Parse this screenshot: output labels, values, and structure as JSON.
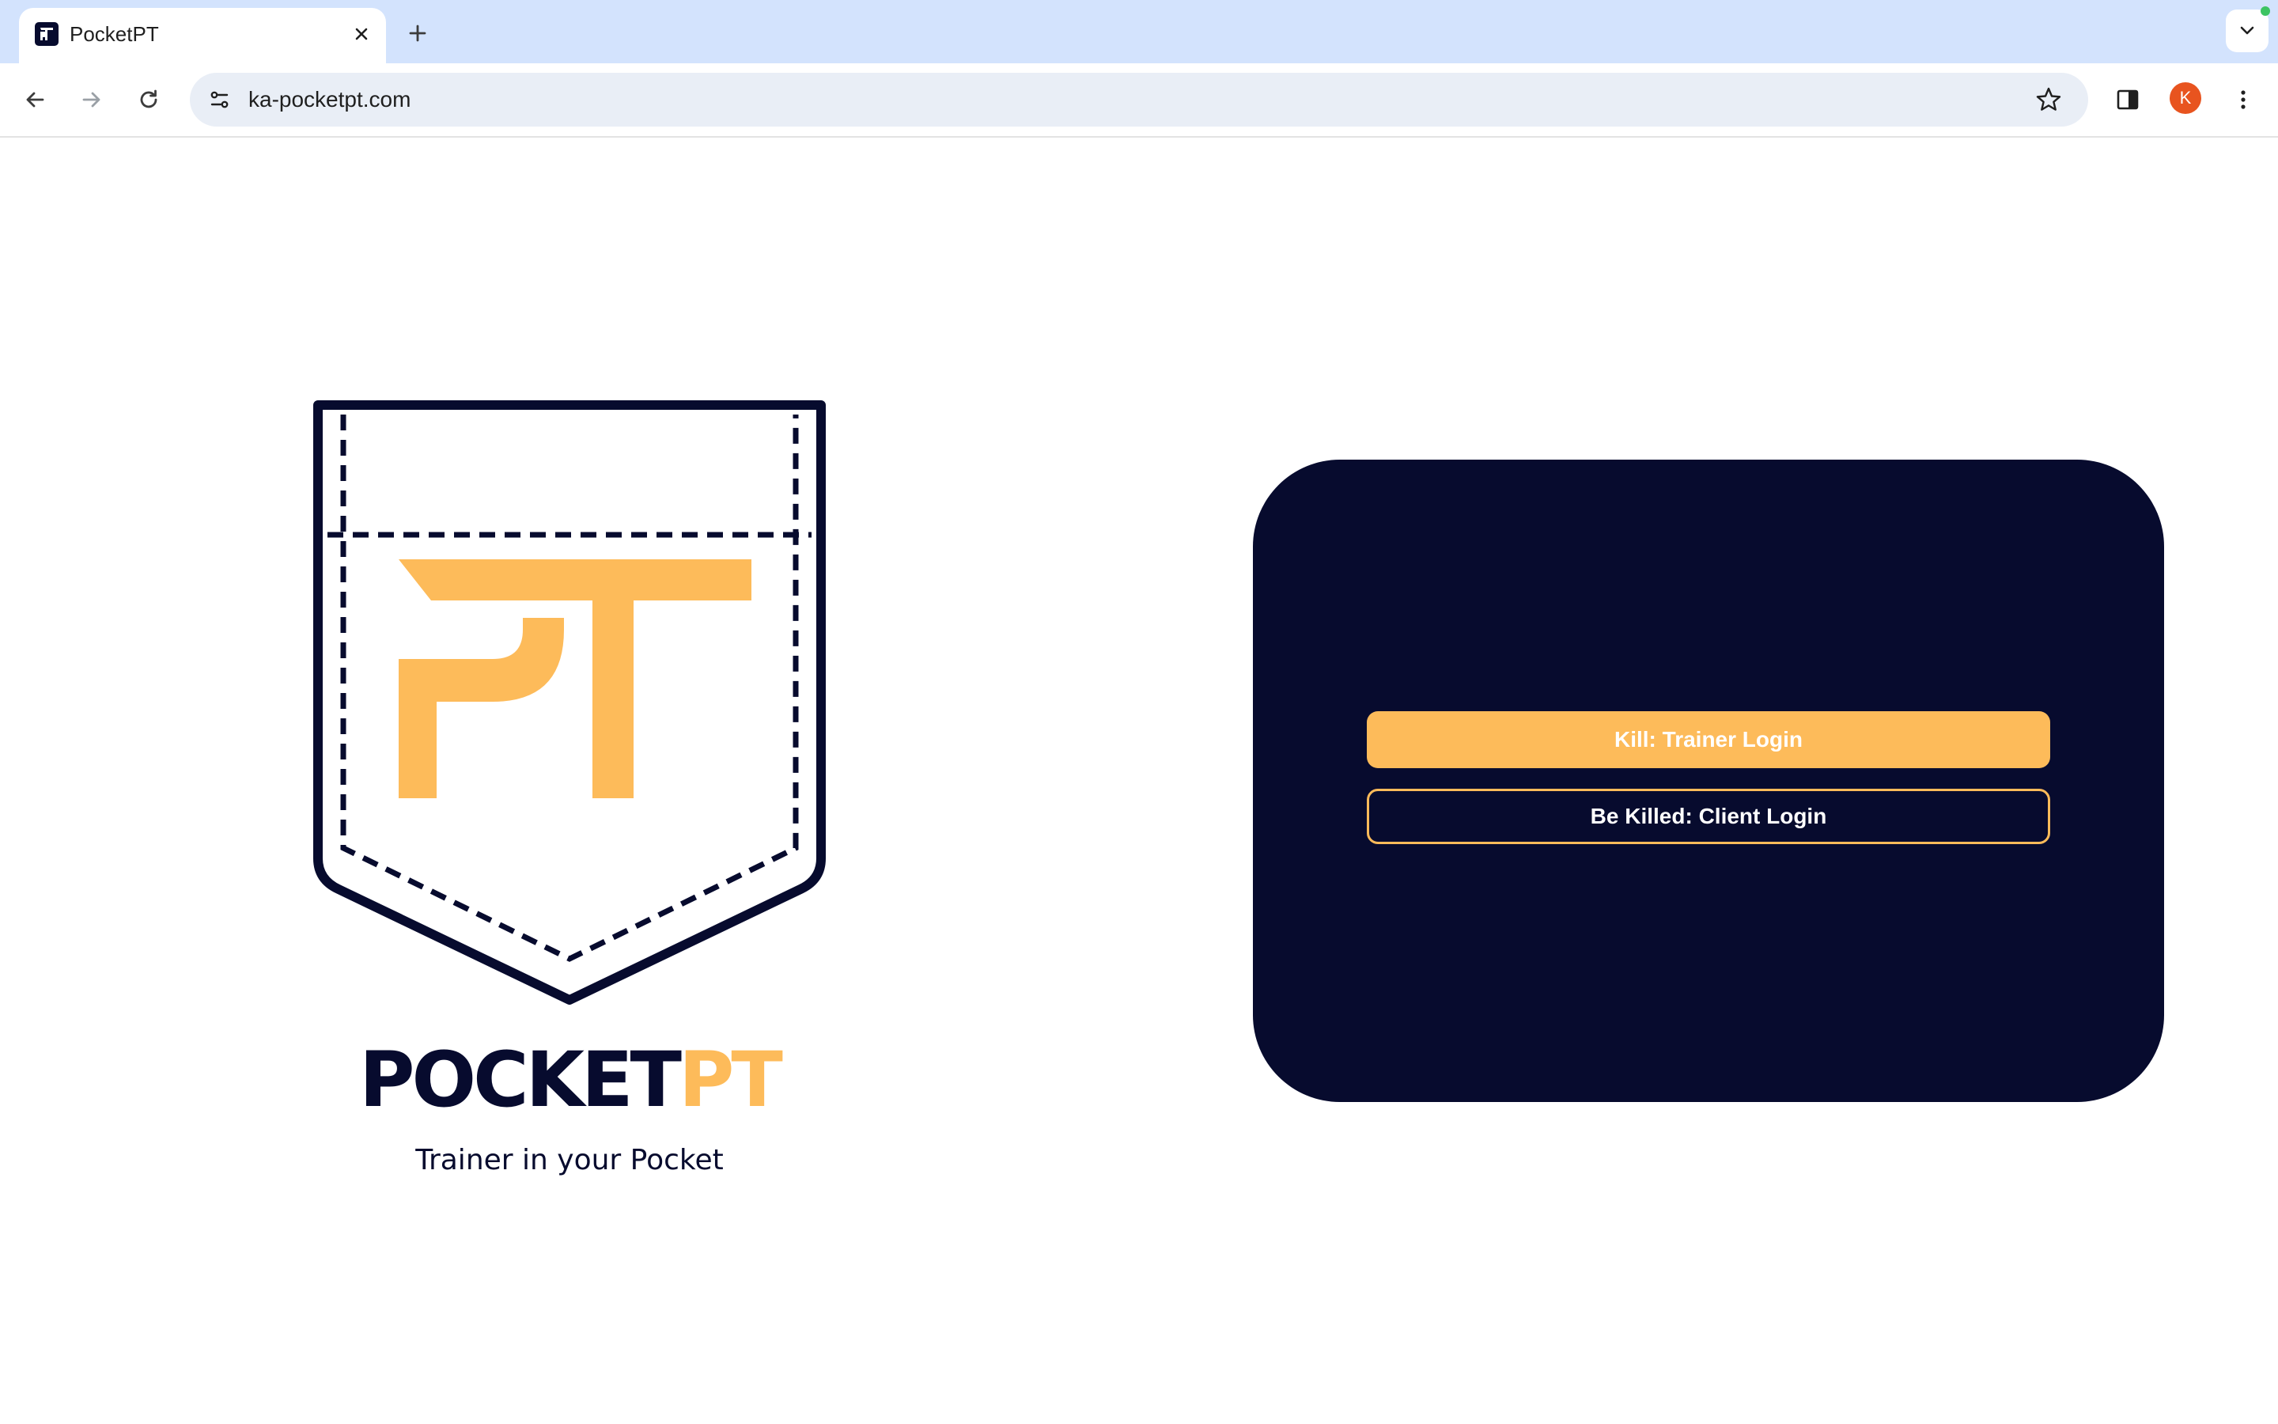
{
  "browser": {
    "tab": {
      "title": "PocketPT",
      "favicon_icon": "pocketpt-favicon-icon",
      "close_icon": "close-icon"
    },
    "new_tab_icon": "plus-icon",
    "tab_search_icon": "chevron-down-icon",
    "toolbar": {
      "back_icon": "arrow-left-icon",
      "forward_icon": "arrow-right-icon",
      "reload_icon": "reload-icon",
      "site_info_icon": "tune-icon",
      "url": "ka-pocketpt.com",
      "bookmark_icon": "star-icon",
      "side_panel_icon": "side-panel-icon",
      "profile_initial": "K",
      "menu_icon": "kebab-menu-icon"
    }
  },
  "page": {
    "logo": {
      "icon": "pocket-pt-logo",
      "brand_part1": "POCKET",
      "brand_part2": "PT",
      "tagline": "Trainer in your Pocket"
    },
    "login": {
      "trainer_button": "Kill: Trainer Login",
      "client_button": "Be Killed: Client Login"
    }
  },
  "colors": {
    "navy": "#070b2e",
    "accent": "#fdbb5a",
    "tabstrip": "#d3e3fd",
    "omnibox": "#e9eef6",
    "avatar": "#e8541f"
  }
}
